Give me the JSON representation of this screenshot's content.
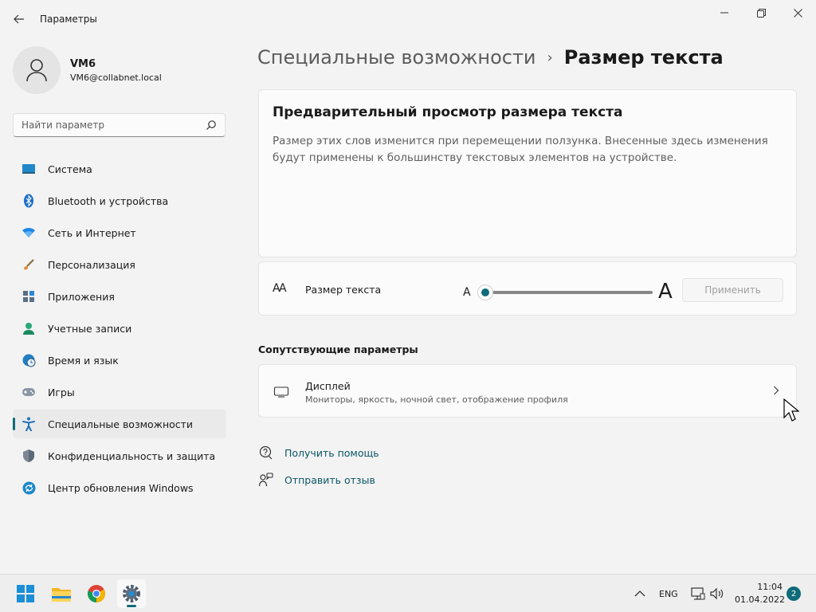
{
  "window": {
    "title": "Параметры",
    "controls": [
      "minimize",
      "maximize",
      "close"
    ]
  },
  "profile": {
    "name": "VM6",
    "email": "VM6@collabnet.local"
  },
  "search": {
    "placeholder": "Найти параметр"
  },
  "sidebar": {
    "items": [
      {
        "label": "Система",
        "icon": "system-icon"
      },
      {
        "label": "Bluetooth и устройства",
        "icon": "bluetooth-icon"
      },
      {
        "label": "Сеть и Интернет",
        "icon": "network-icon"
      },
      {
        "label": "Персонализация",
        "icon": "brush-icon"
      },
      {
        "label": "Приложения",
        "icon": "apps-icon"
      },
      {
        "label": "Учетные записи",
        "icon": "accounts-icon"
      },
      {
        "label": "Время и язык",
        "icon": "time-language-icon"
      },
      {
        "label": "Игры",
        "icon": "gaming-icon"
      },
      {
        "label": "Специальные возможности",
        "icon": "accessibility-icon",
        "active": true
      },
      {
        "label": "Конфиденциальность и защита",
        "icon": "shield-icon"
      },
      {
        "label": "Центр обновления Windows",
        "icon": "update-icon"
      }
    ]
  },
  "breadcrumb": {
    "parent": "Специальные возможности",
    "separator": "›",
    "current": "Размер текста"
  },
  "preview": {
    "title": "Предварительный просмотр размера текста",
    "description": "Размер этих слов изменится при перемещении ползунка. Внесенные здесь изменения будут применены к большинству текстовых элементов на устройстве."
  },
  "text_size": {
    "icon_glyph": "AA",
    "label": "Размер текста",
    "small_a": "A",
    "large_a": "A",
    "slider_value_fraction": 0.0,
    "apply_label": "Применить"
  },
  "related": {
    "heading": "Сопутствующие параметры",
    "display": {
      "title": "Дисплей",
      "subtitle": "Мониторы, яркость, ночной свет, отображение профиля"
    }
  },
  "links": {
    "help": "Получить помощь",
    "feedback": "Отправить отзыв"
  },
  "taskbar": {
    "apps": [
      "start-icon",
      "file-explorer-icon",
      "chrome-icon",
      "settings-icon"
    ],
    "language": "ENG",
    "time": "11:04",
    "date": "01.04.2022",
    "notifications": "2"
  },
  "colors": {
    "accent": "#0f6b7a",
    "background": "#f3f3f3",
    "card": "#fbfbfb"
  }
}
